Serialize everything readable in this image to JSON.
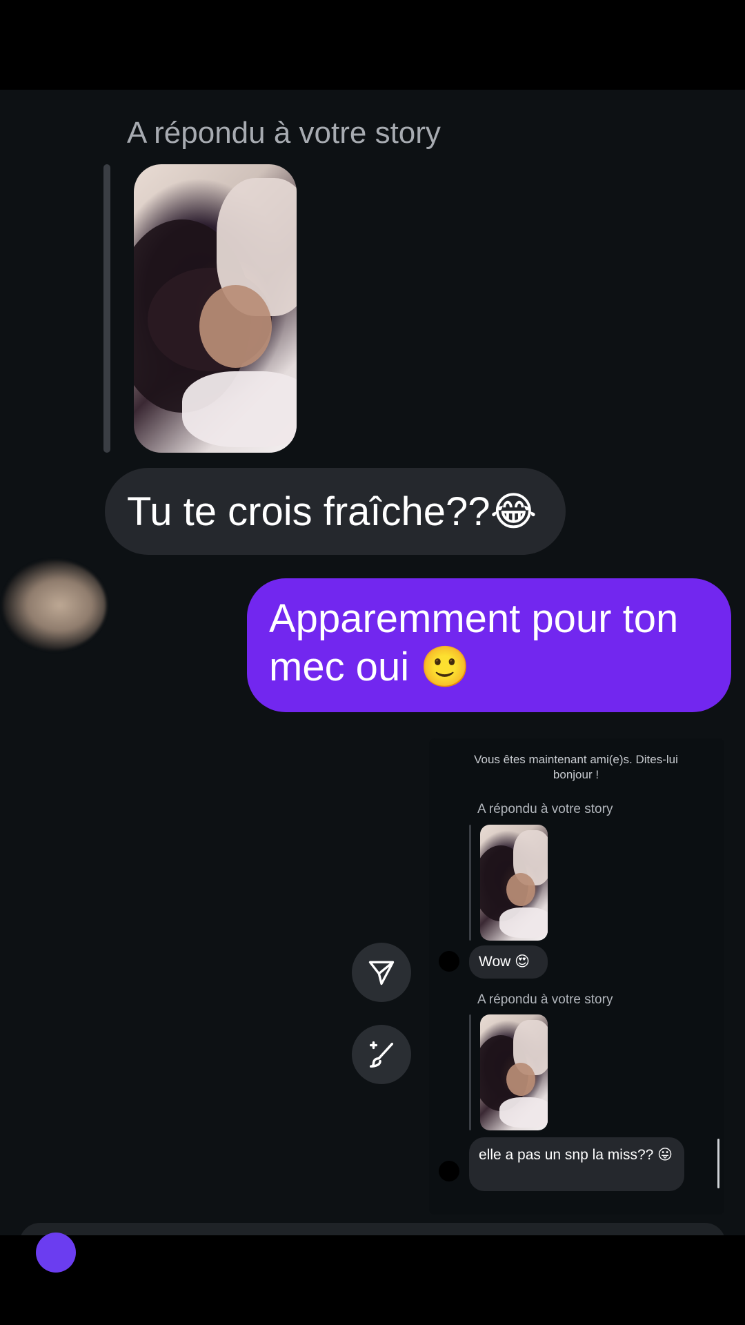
{
  "chat": {
    "story_caption": "A répondu à votre story",
    "incoming_message": "Tu te crois fraîche??😂",
    "outgoing_message": "Apparemment pour ton mec oui 🙂"
  },
  "embedded_screenshot": {
    "notice": "Vous êtes maintenant ami(e)s. Dites-lui bonjour !",
    "story_caption_1": "A répondu à votre story",
    "message_1": "Wow 😍",
    "story_caption_2": "A répondu à votre story",
    "message_2": "elle a pas un snp la miss?? 😛"
  },
  "actions": {
    "send_icon": "paper-plane-icon",
    "edit_icon": "sparkle-brush-icon"
  },
  "colors": {
    "background": "#0d1114",
    "incoming_bubble": "#25282d",
    "outgoing_bubble": "#7227ef",
    "caption_text": "#a7abb1"
  }
}
